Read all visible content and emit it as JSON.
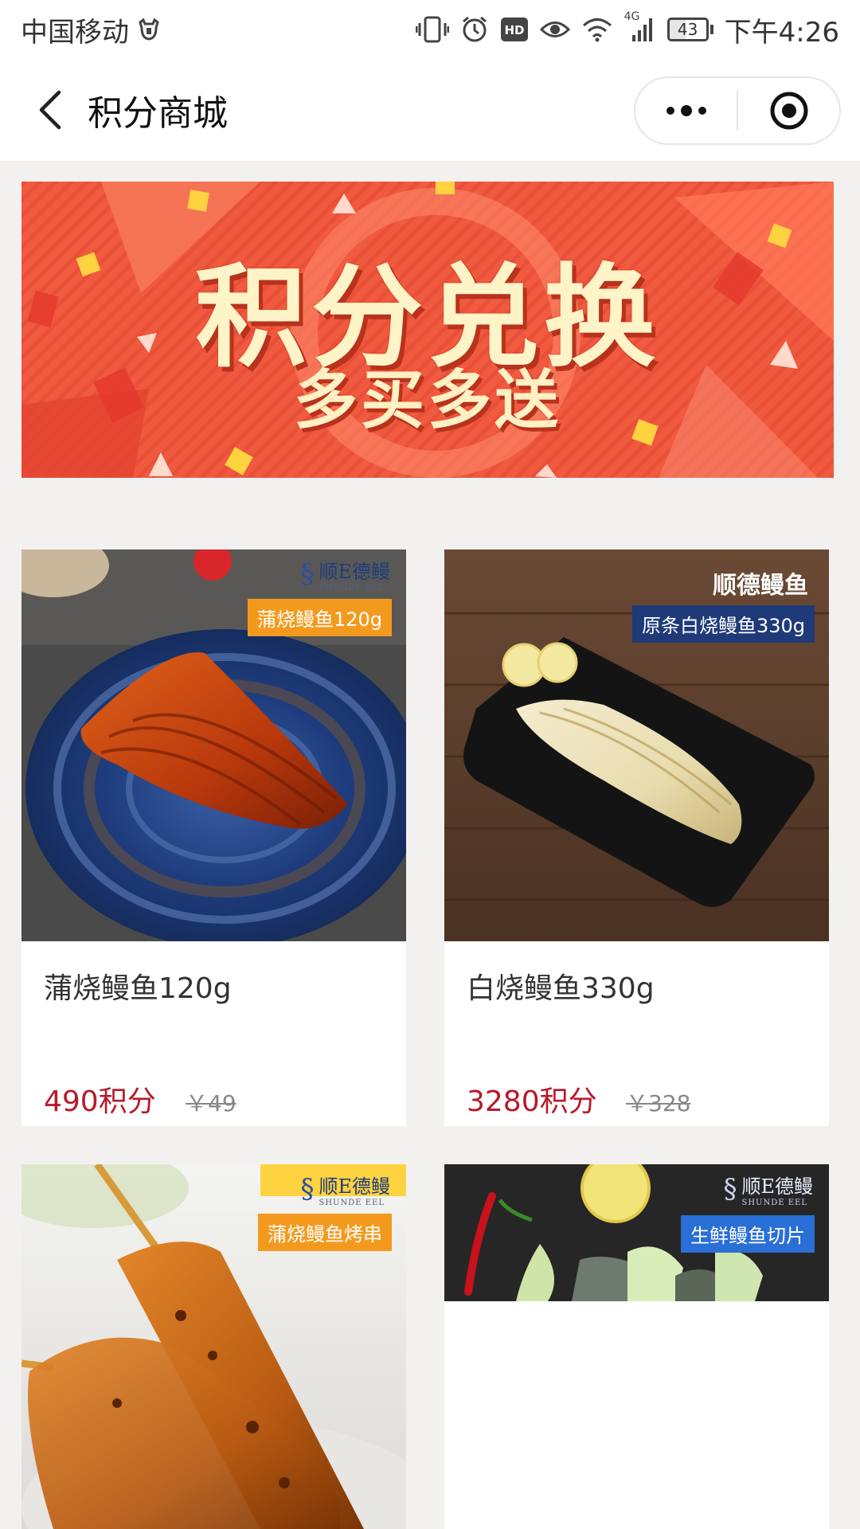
{
  "status_bar": {
    "carrier": "中国移动",
    "network": "4G",
    "battery": "43",
    "time": "下午4:26"
  },
  "nav": {
    "title": "积分商城"
  },
  "banner": {
    "title": "积分兑换",
    "subtitle": "多买多送"
  },
  "products": [
    {
      "name": "蒲烧鳗鱼120g",
      "points": "490积分",
      "price": "￥49",
      "tag": "蒲烧鳗鱼120g",
      "tag_color": "#f39a1e"
    },
    {
      "name": "白烧鳗鱼330g",
      "points": "3280积分",
      "price": "￥328",
      "brand_text": "顺德鳗鱼",
      "tag": "原条白烧鳗鱼330g",
      "tag_color": "#1f3a78"
    },
    {
      "tag": "蒲烧鳗鱼烤串",
      "tag_color": "#f39a1e"
    },
    {
      "tag": "生鲜鳗鱼切片",
      "tag_color": "#2a6fd6"
    }
  ],
  "brand": {
    "logo_text": "顺E德鳗",
    "logo_sub": "SHUNDE EEL"
  },
  "colors": {
    "points": "#b8192a",
    "banner_bg": "#f05a3e"
  }
}
